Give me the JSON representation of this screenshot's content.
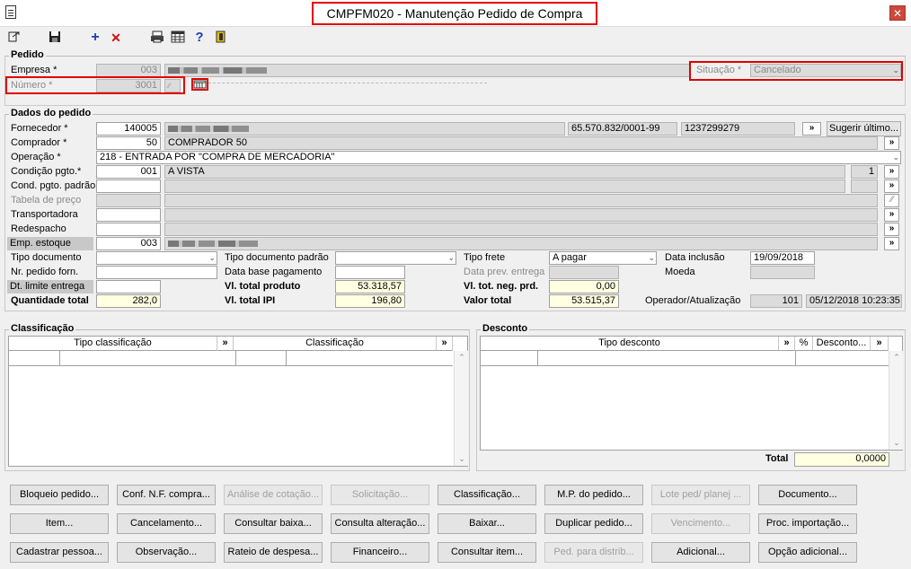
{
  "window": {
    "title": "CMPFM020 - Manutenção Pedido de Compra",
    "close": "✕"
  },
  "toolbar": {
    "icons": [
      "export-icon",
      "save-icon",
      "add-icon",
      "delete-icon",
      "print-icon",
      "calculator-icon",
      "help-icon",
      "exit-icon"
    ],
    "add": "+",
    "delete": "✕",
    "help": "?"
  },
  "pedido": {
    "legend": "Pedido",
    "empresa_label": "Empresa *",
    "empresa_code": "003",
    "numero_label": "Número *",
    "numero_value": "3001",
    "situacao_label": "Situação *",
    "situacao_value": "Cancelado"
  },
  "dados": {
    "legend": "Dados do pedido",
    "fornecedor_label": "Fornecedor *",
    "fornecedor_code": "140005",
    "fornecedor_cnpj": "65.570.832/0001-99",
    "fornecedor_ie": "1237299279",
    "sugerir_label": "Sugerir último...",
    "comprador_label": "Comprador *",
    "comprador_code": "50",
    "comprador_name": "COMPRADOR 50",
    "operacao_label": "Operação *",
    "operacao_value": "218 - ENTRADA POR \"COMPRA DE MERCADORIA\"",
    "condicao_label": "Condição pgto.*",
    "condicao_code": "001",
    "condicao_name": "A VISTA",
    "condicao_parc": "1",
    "cond_padrao_label": "Cond. pgto. padrão",
    "tabela_label": "Tabela de preço",
    "transportadora_label": "Transportadora",
    "redespacho_label": "Redespacho",
    "emp_estoque_label": "Emp. estoque",
    "emp_estoque_code": "003",
    "tipo_doc_label": "Tipo documento",
    "nr_pedido_label": "Nr. pedido forn.",
    "dt_limite_label": "Dt. limite entrega",
    "qtd_total_label": "Quantidade total",
    "qtd_total_value": "282,0",
    "tipo_doc_padrao_label": "Tipo documento padrão",
    "data_base_label": "Data base pagamento",
    "vl_total_prod_label": "Vl. total produto",
    "vl_total_prod_value": "53.318,57",
    "vl_total_ipi_label": "Vl. total IPI",
    "vl_total_ipi_value": "196,80",
    "tipo_frete_label": "Tipo frete",
    "tipo_frete_value": "A pagar",
    "data_prev_label": "Data prev. entrega",
    "vl_tot_neg_label": "Vl. tot. neg. prd.",
    "vl_tot_neg_value": "0,00",
    "valor_total_label": "Valor total",
    "valor_total_value": "53.515,37",
    "data_inclusao_label": "Data inclusão",
    "data_inclusao_value": "19/09/2018",
    "moeda_label": "Moeda",
    "operador_label": "Operador/Atualização",
    "operador_value": "101",
    "atualizacao_value": "05/12/2018 10:23:35"
  },
  "classificacao": {
    "legend": "Classificação",
    "col_tipo": "Tipo classificação",
    "col_class": "Classificação"
  },
  "desconto": {
    "legend": "Desconto",
    "col_tipo": "Tipo desconto",
    "col_pct": "%",
    "col_desc": "Desconto...",
    "total_label": "Total",
    "total_value": "0,0000"
  },
  "lookup_glyph": "»",
  "buttons": {
    "row1": [
      "Bloqueio pedido...",
      "Conf. N.F. compra...",
      "Análise de cotação...",
      "Solicitação...",
      "Classificação...",
      "M.P. do pedido...",
      "Lote ped/ planej ...",
      "Documento..."
    ],
    "row2": [
      "Item...",
      "Cancelamento...",
      "Consultar baixa...",
      "Consulta alteração...",
      "Baixar...",
      "Duplicar pedido...",
      "Vencimento...",
      "Proc. importação..."
    ],
    "row3": [
      "Cadastrar pessoa...",
      "Observação...",
      "Rateio de despesa...",
      "Financeiro...",
      "Consultar item...",
      "Ped. para distrib...",
      "Adicional...",
      "Opção adicional..."
    ]
  }
}
